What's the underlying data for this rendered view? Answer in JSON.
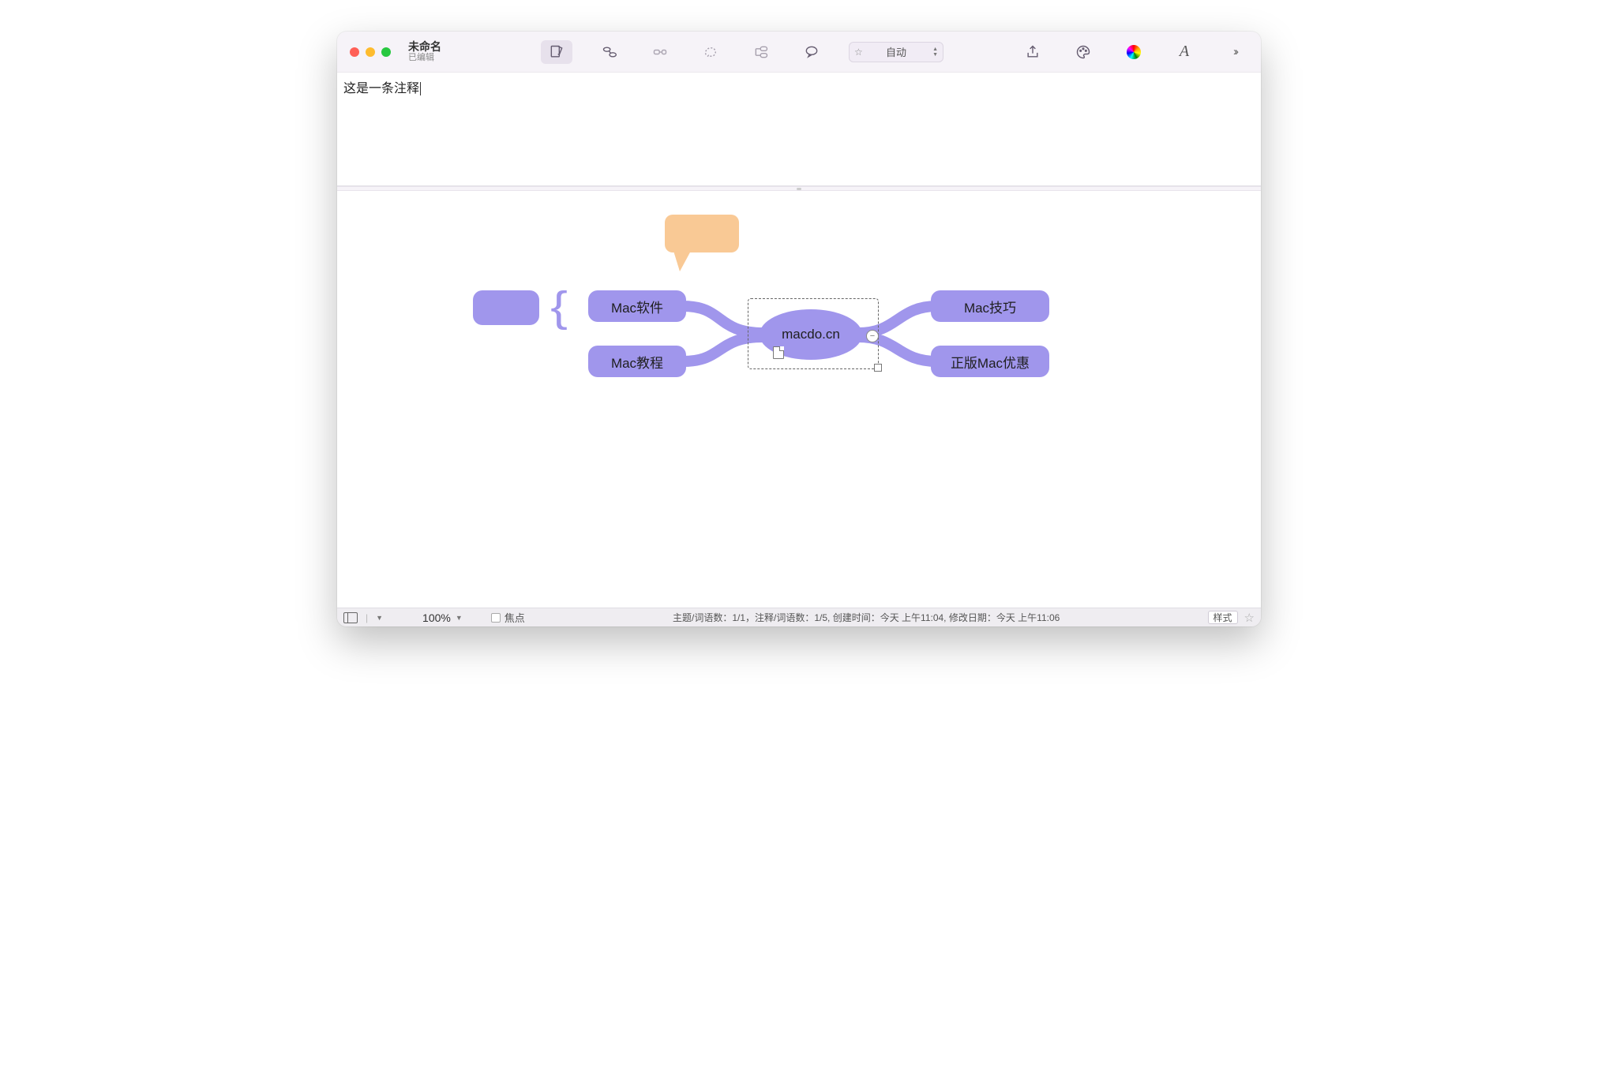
{
  "window": {
    "title": "未命名",
    "subtitle": "已编辑"
  },
  "toolbar": {
    "autoLabel": "自动"
  },
  "note": {
    "text": "这是一条注释"
  },
  "mindmap": {
    "center": "macdo.cn",
    "left1": "Mac软件",
    "left2": "Mac教程",
    "right1": "Mac技巧",
    "right2": "正版Mac优惠"
  },
  "statusbar": {
    "zoom": "100%",
    "focusLabel": "焦点",
    "info": "主题/词语数：1/1，注释/词语数：1/5, 创建时间：今天 上午11:04, 修改日期：今天 上午11:06",
    "styleLabel": "样式"
  }
}
